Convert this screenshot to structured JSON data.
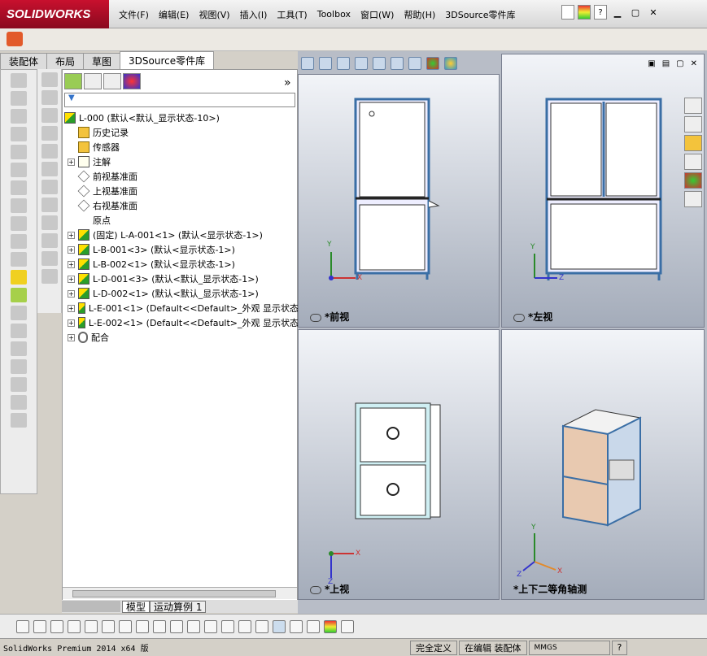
{
  "app": {
    "logo_text": "SOLIDWORKS"
  },
  "menu": [
    "文件(F)",
    "编辑(E)",
    "视图(V)",
    "插入(I)",
    "工具(T)",
    "Toolbox",
    "窗口(W)",
    "帮助(H)",
    "3DSource零件库"
  ],
  "command_tabs": [
    "装配体",
    "布局",
    "草图",
    "3DSource零件库"
  ],
  "tree": {
    "root": "L-000  (默认<默认_显示状态-10>)",
    "items": [
      {
        "label": "历史记录",
        "icon": "history-icon",
        "expand": false
      },
      {
        "label": "传感器",
        "icon": "sensor-icon",
        "expand": false
      },
      {
        "label": "注解",
        "icon": "annotation-icon",
        "expand": true
      },
      {
        "label": "前视基准面",
        "icon": "plane-icon",
        "expand": false
      },
      {
        "label": "上视基准面",
        "icon": "plane-icon",
        "expand": false
      },
      {
        "label": "右视基准面",
        "icon": "plane-icon",
        "expand": false
      },
      {
        "label": "原点",
        "icon": "origin-icon",
        "expand": false
      },
      {
        "label": "(固定) L-A-001<1> (默认<显示状态-1>)",
        "icon": "part-icon",
        "expand": true
      },
      {
        "label": "L-B-001<3> (默认<显示状态-1>)",
        "icon": "part-icon",
        "expand": true
      },
      {
        "label": "L-B-002<1> (默认<显示状态-1>)",
        "icon": "part-icon",
        "expand": true
      },
      {
        "label": "L-D-001<3> (默认<默认_显示状态-1>)",
        "icon": "part-icon",
        "expand": true
      },
      {
        "label": "L-D-002<1> (默认<默认_显示状态-1>)",
        "icon": "part-icon",
        "expand": true
      },
      {
        "label": "L-E-001<1> (Default<<Default>_外观 显示状态",
        "icon": "part-icon",
        "expand": true
      },
      {
        "label": "L-E-002<1> (Default<<Default>_外观 显示状态",
        "icon": "part-icon",
        "expand": true
      },
      {
        "label": "配合",
        "icon": "mate-icon",
        "expand": true
      }
    ]
  },
  "bottom_tabs": [
    "模型",
    "运动算例 1"
  ],
  "views": {
    "front": "*前视",
    "left": "*左视",
    "top": "*上视",
    "iso": "*上下二等角轴测"
  },
  "axes": {
    "x": "X",
    "y": "Y",
    "z": "Z"
  },
  "status": {
    "product": "SolidWorks Premium 2014 x64 版",
    "definition": "完全定义",
    "mode": "在编辑 装配体",
    "units": "MMGS",
    "help": "?"
  },
  "expander_open": "+",
  "more_glyph": "»"
}
